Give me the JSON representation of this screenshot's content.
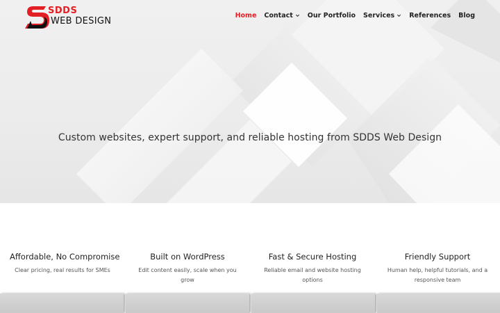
{
  "header": {
    "logo": {
      "top_text": "SDDS",
      "bottom_text": "WEB DESIGN"
    },
    "nav": [
      {
        "label": "Home",
        "active": true,
        "has_dropdown": false
      },
      {
        "label": "Contact",
        "active": false,
        "has_dropdown": true
      },
      {
        "label": "Our Portfolio",
        "active": false,
        "has_dropdown": false
      },
      {
        "label": "Services",
        "active": false,
        "has_dropdown": true
      },
      {
        "label": "References",
        "active": false,
        "has_dropdown": false
      },
      {
        "label": "Blog",
        "active": false,
        "has_dropdown": false
      }
    ]
  },
  "hero": {
    "tagline": "Custom websites, expert support, and reliable hosting from SDDS Web Design"
  },
  "features": [
    {
      "title": "Affordable, No Compromise",
      "description": "Clear pricing, real results for SMEs"
    },
    {
      "title": "Built on WordPress",
      "description": "Edit content easily, scale when you grow"
    },
    {
      "title": "Fast & Secure Hosting",
      "description": "Reliable email and website hosting options"
    },
    {
      "title": "Friendly Support",
      "description": "Human help, helpful tutorials, and a responsive team"
    }
  ],
  "colors": {
    "brand_red": "#e31e24",
    "text_dark": "#222222",
    "hero_bg": "#ececec"
  }
}
